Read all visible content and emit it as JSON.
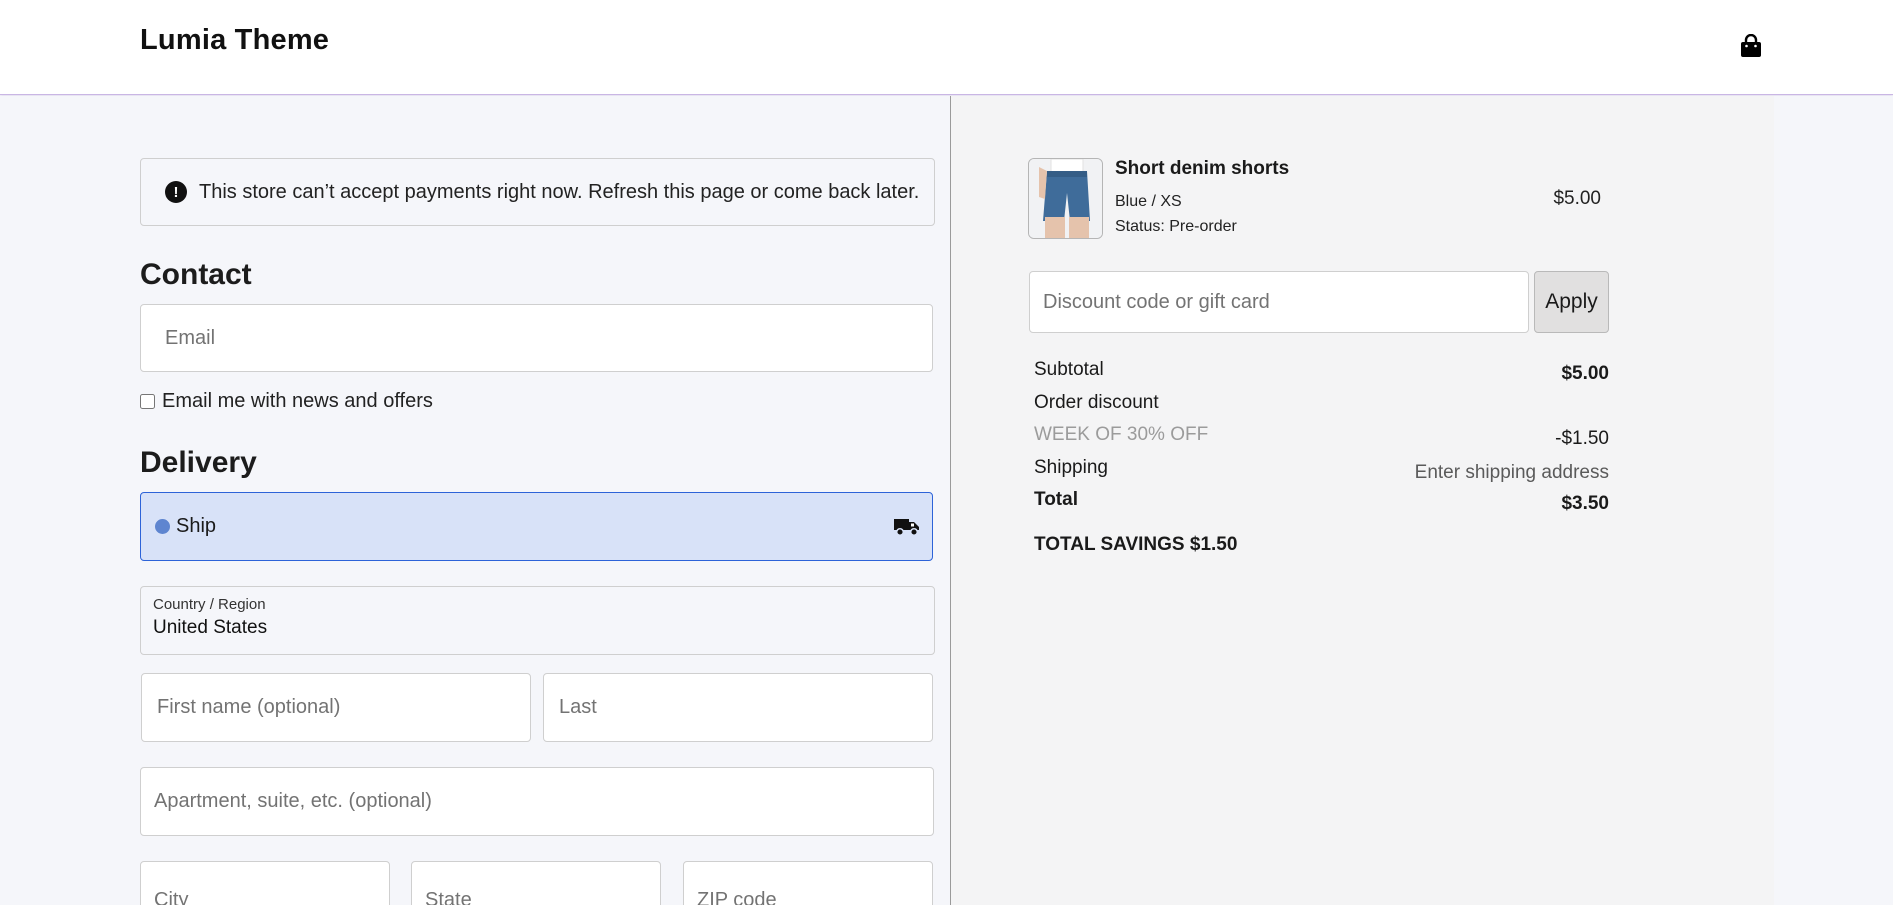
{
  "header": {
    "brand": "Lumia Theme",
    "cart_icon": "shopping-bag-icon"
  },
  "alert": {
    "icon": "exclamation-circle-icon",
    "text": "This store can’t accept payments right now. Refresh this page or come back later."
  },
  "contact": {
    "title": "Contact",
    "email_placeholder": "Email",
    "newsletter_label": "Email me with news and offers",
    "newsletter_checked": false
  },
  "delivery": {
    "title": "Delivery",
    "ship_option": {
      "label": "Ship",
      "selected": true,
      "icon": "truck-icon"
    },
    "country": {
      "label": "Country / Region",
      "value": "United States"
    },
    "first_name_placeholder": "First name (optional)",
    "last_name_placeholder": "Last",
    "apartment_placeholder": "Apartment, suite, etc. (optional)",
    "city_placeholder": "City",
    "state_placeholder": "State",
    "zip_placeholder": "ZIP code"
  },
  "summary": {
    "product": {
      "name": "Short denim shorts",
      "variant": "Blue / XS",
      "status": "Status: Pre-order",
      "price": "$5.00"
    },
    "discount_placeholder": "Discount code or gift card",
    "apply_label": "Apply",
    "subtotal_label": "Subtotal",
    "subtotal_value": "$5.00",
    "order_discount_label": "Order discount",
    "discount_code": "WEEK OF 30% OFF",
    "discount_value": "-$1.50",
    "shipping_label": "Shipping",
    "shipping_value": "Enter shipping address",
    "total_label": "Total",
    "total_value": "$3.50",
    "savings_text": "TOTAL SAVINGS $1.50"
  },
  "colors": {
    "accent": "#2d63d8",
    "ship_bg": "#d8e2f8",
    "summary_bg": "#f4f4f5"
  }
}
